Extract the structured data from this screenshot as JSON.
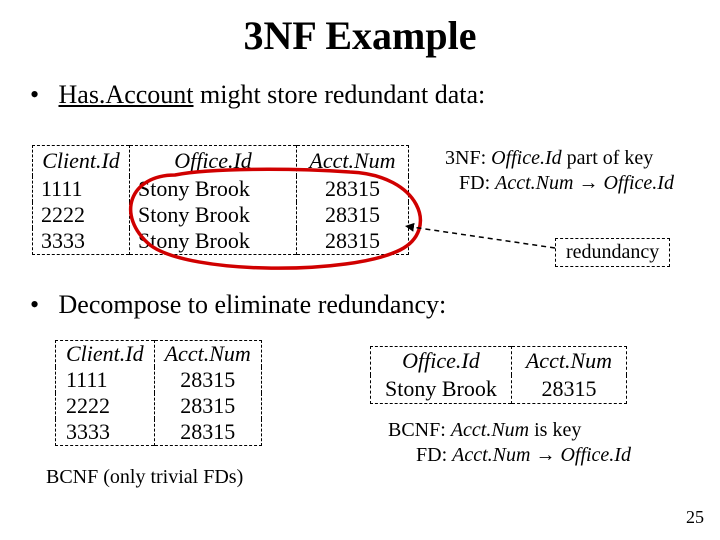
{
  "title": "3NF Example",
  "bullet1_pre": "Has.Account",
  "bullet1_post": " might store redundant data:",
  "top_table": {
    "hdr": {
      "c1": "Client.Id",
      "c2": "Office.Id",
      "c3": "Acct.Num"
    },
    "rows": [
      {
        "c1": "1111",
        "c2": "Stony Brook",
        "c3": "28315"
      },
      {
        "c1": "2222",
        "c2": "Stony Brook",
        "c3": "28315"
      },
      {
        "c1": "3333",
        "c2": "Stony Brook",
        "c3": "28315"
      }
    ]
  },
  "note_3nf": {
    "l1a": "3NF: ",
    "l1b": "Office.Id ",
    "l1c": "part of key",
    "l2a": "FD: ",
    "l2b": "Acct.Num ",
    "l2arrow": "→",
    "l2c": " Office.Id"
  },
  "redundancy_label": "redundancy",
  "bullet2": "Decompose to eliminate redundancy:",
  "bl_table": {
    "hdr": {
      "c1": "Client.Id",
      "c2": "Acct.Num"
    },
    "rows": [
      {
        "c1": "1111",
        "c2": "28315"
      },
      {
        "c1": "2222",
        "c2": "28315"
      },
      {
        "c1": "3333",
        "c2": "28315"
      }
    ]
  },
  "bcnf_caption": "BCNF (only trivial FDs)",
  "br_table": {
    "hdr": {
      "c1": "Office.Id",
      "c2": "Acct.Num"
    },
    "rows": [
      {
        "c1": "Stony Brook",
        "c2": "28315"
      }
    ]
  },
  "bcnf_note": {
    "l1a": "BCNF: ",
    "l1b": "Acct.Num ",
    "l1c": "is key",
    "l2a": "FD: ",
    "l2b": "Acct.Num ",
    "l2arrow": "→",
    "l2c": " Office.Id"
  },
  "page_num": "25"
}
